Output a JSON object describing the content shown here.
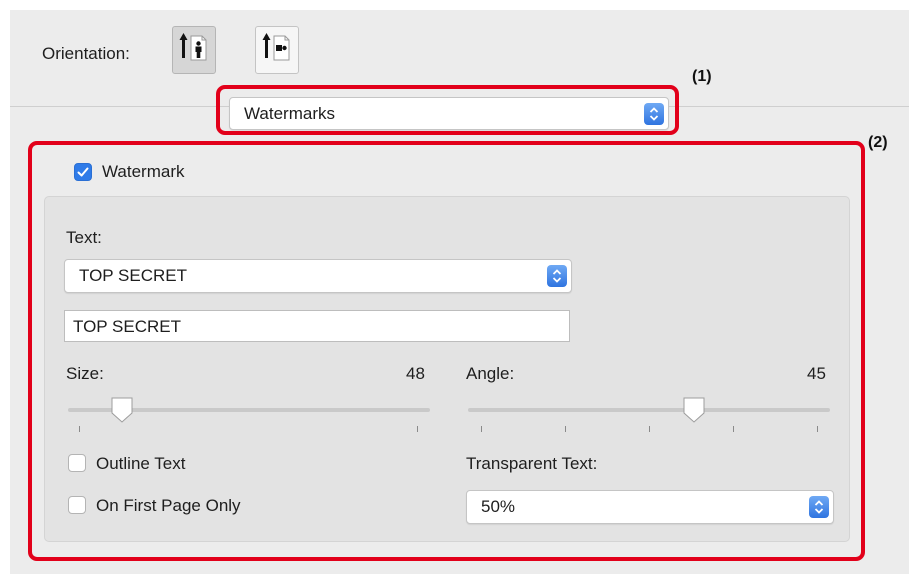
{
  "orientation": {
    "label": "Orientation:",
    "options": [
      {
        "name": "portrait",
        "selected": true
      },
      {
        "name": "landscape",
        "selected": false
      }
    ]
  },
  "panel_menu": {
    "selected": "Watermarks"
  },
  "callouts": {
    "one": "(1)",
    "two": "(2)"
  },
  "watermark": {
    "enabled": true,
    "label": "Watermark",
    "text_label": "Text:",
    "text_preset": "TOP SECRET",
    "text_value": "TOP SECRET",
    "size": {
      "label": "Size:",
      "value": "48",
      "level": 0.15
    },
    "angle": {
      "label": "Angle:",
      "value": "45",
      "level": 0.625
    },
    "outline_text": {
      "label": "Outline Text",
      "checked": false
    },
    "first_page_only": {
      "label": "On First Page Only",
      "checked": false
    },
    "transparent_text": {
      "label": "Transparent Text:",
      "value": "50%"
    }
  },
  "colors": {
    "accent": "#2f7be8",
    "annotation": "#e2001a",
    "panel": "#ececec"
  }
}
